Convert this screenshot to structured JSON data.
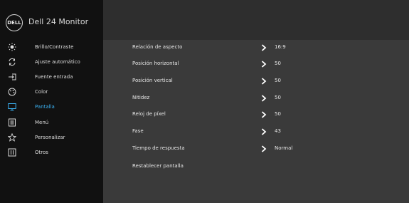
{
  "header": {
    "logo_text": "DELL",
    "model": "Dell 24 Monitor"
  },
  "sidebar": {
    "items": [
      {
        "label": "Brillo/Contraste",
        "icon": "brightness-icon"
      },
      {
        "label": "Ajuste automático",
        "icon": "auto-adjust-icon"
      },
      {
        "label": "Fuente entrada",
        "icon": "input-source-icon"
      },
      {
        "label": "Color",
        "icon": "color-icon"
      },
      {
        "label": "Pantalla",
        "icon": "display-icon"
      },
      {
        "label": "Menú",
        "icon": "menu-icon"
      },
      {
        "label": "Personalizar",
        "icon": "star-icon"
      },
      {
        "label": "Otros",
        "icon": "others-icon"
      }
    ],
    "active_index": 4
  },
  "display_settings": {
    "rows": [
      {
        "label": "Relación de aspecto",
        "value": "16:9"
      },
      {
        "label": "Posición horizontal",
        "value": "50"
      },
      {
        "label": "Posición vertical",
        "value": "50"
      },
      {
        "label": "Nitidez",
        "value": "50"
      },
      {
        "label": "Reloj de píxel",
        "value": "50"
      },
      {
        "label": "Fase",
        "value": "43"
      },
      {
        "label": "Tiempo de respuesta",
        "value": "Normal"
      },
      {
        "label": "Restablecer pantalla",
        "value": ""
      }
    ]
  },
  "colors": {
    "accent": "#3bb0f0",
    "sidebar_bg": "#111111",
    "main_bg": "#3a3a3a"
  }
}
